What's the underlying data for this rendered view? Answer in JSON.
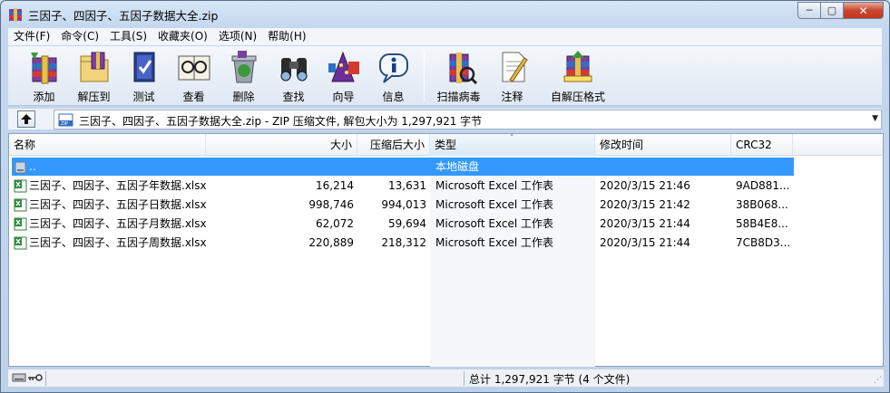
{
  "window": {
    "title": "三因子、四因子、五因子数据大全.zip",
    "min_label": "─",
    "max_label": "▢",
    "close_label": "✕"
  },
  "menu": [
    "文件(F)",
    "命令(C)",
    "工具(S)",
    "收藏夹(O)",
    "选项(N)",
    "帮助(H)"
  ],
  "toolbar": [
    {
      "label": "添加",
      "icon": "add-archive-icon"
    },
    {
      "label": "解压到",
      "icon": "extract-to-icon"
    },
    {
      "label": "测试",
      "icon": "test-icon"
    },
    {
      "label": "查看",
      "icon": "view-icon"
    },
    {
      "label": "删除",
      "icon": "delete-icon"
    },
    {
      "label": "查找",
      "icon": "find-icon"
    },
    {
      "label": "向导",
      "icon": "wizard-icon"
    },
    {
      "label": "信息",
      "icon": "info-icon"
    },
    {
      "label": "扫描病毒",
      "icon": "virus-scan-icon"
    },
    {
      "label": "注释",
      "icon": "comment-icon"
    },
    {
      "label": "自解压格式",
      "icon": "sfx-icon"
    }
  ],
  "address": {
    "text": "三因子、四因子、五因子数据大全.zip - ZIP 压缩文件, 解包大小为 1,297,921 字节"
  },
  "columns": {
    "name": "名称",
    "size": "大小",
    "packed": "压缩后大小",
    "type": "类型",
    "modified": "修改时间",
    "crc": "CRC32"
  },
  "parent_row": {
    "name": "..",
    "type": "本地磁盘"
  },
  "files": [
    {
      "name": "三因子、四因子、五因子年数据.xlsx",
      "size": "16,214",
      "packed": "13,631",
      "type": "Microsoft Excel 工作表",
      "modified": "2020/3/15 21:46",
      "crc": "9AD881..."
    },
    {
      "name": "三因子、四因子、五因子日数据.xlsx",
      "size": "998,746",
      "packed": "994,013",
      "type": "Microsoft Excel 工作表",
      "modified": "2020/3/15 21:42",
      "crc": "38B068..."
    },
    {
      "name": "三因子、四因子、五因子月数据.xlsx",
      "size": "62,072",
      "packed": "59,694",
      "type": "Microsoft Excel 工作表",
      "modified": "2020/3/15 21:44",
      "crc": "58B4E8..."
    },
    {
      "name": "三因子、四因子、五因子周数据.xlsx",
      "size": "220,889",
      "packed": "218,312",
      "type": "Microsoft Excel 工作表",
      "modified": "2020/3/15 21:44",
      "crc": "7CB8D3..."
    }
  ],
  "status": {
    "text": "总计 1,297,921 字节 (4 个文件)"
  },
  "colors": {
    "selection": "#3399ff",
    "titlebar": "#c3d7ee",
    "close_button": "#c9462c"
  }
}
